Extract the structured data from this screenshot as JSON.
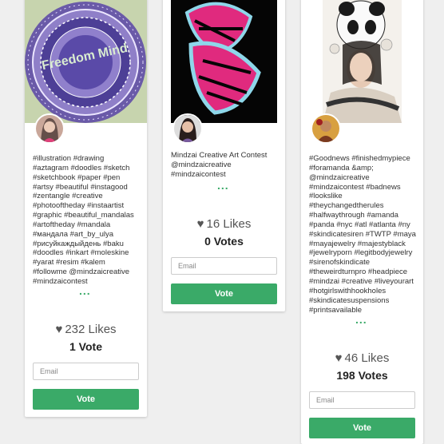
{
  "cards": [
    {
      "tags": [
        "#illustration #drawing",
        "#aztagram #doodles #sketch",
        "#sketchbook #paper #pen",
        "#artsy #beautiful #instagood",
        "#zentangle #creative",
        "#photooftheday #instaartist",
        "#graphic #beautiful_mandalas",
        "#artoftheday #mandala",
        "#мандала #art_by_ulya",
        "#рисуйкаждыйдень #baku",
        "#doodles #inkart #moleskine",
        "#yarat #resim #kalem",
        "#followme @mindzaicreative",
        "#mindzaicontest"
      ],
      "more": "...",
      "likes": "232 Likes",
      "votes": "1 Vote",
      "email_placeholder": "Email",
      "vote_label": "Vote",
      "image_text": "Freedom Mind"
    },
    {
      "tags": [
        "Mindzai Creative Art Contest",
        "@mindzaicreative",
        "#mindzaicontest"
      ],
      "more": "...",
      "likes": "16 Likes",
      "votes": "0 Votes",
      "email_placeholder": "Email",
      "vote_label": "Vote"
    },
    {
      "tags": [
        "#Goodnews #finishedmypiece",
        "#foramanda &amp;",
        "@mindzaicreative",
        "#mindzaicontest #badnews",
        "#lookslike",
        "#theychangedtherules",
        "#halfwaythrough #amanda",
        "#panda #nyc #atl #atlanta #ny",
        "#skindicatesiren #TWTP #maya",
        "#mayajewelry #majestyblack",
        "#jewelryporn #legitbodyjewelry",
        "#sirenofskindicate",
        "#theweirdturnpro #headpiece",
        "#mindzai #creative #liveyourart",
        "#hotgirlswithhookholes",
        "#skindicatesuspensions",
        "#printsavailable"
      ],
      "more": "...",
      "likes": "46 Likes",
      "votes": "198 Votes",
      "email_placeholder": "Email",
      "vote_label": "Vote"
    }
  ],
  "colors": {
    "accent": "#3aaa68",
    "background": "#efefef"
  }
}
